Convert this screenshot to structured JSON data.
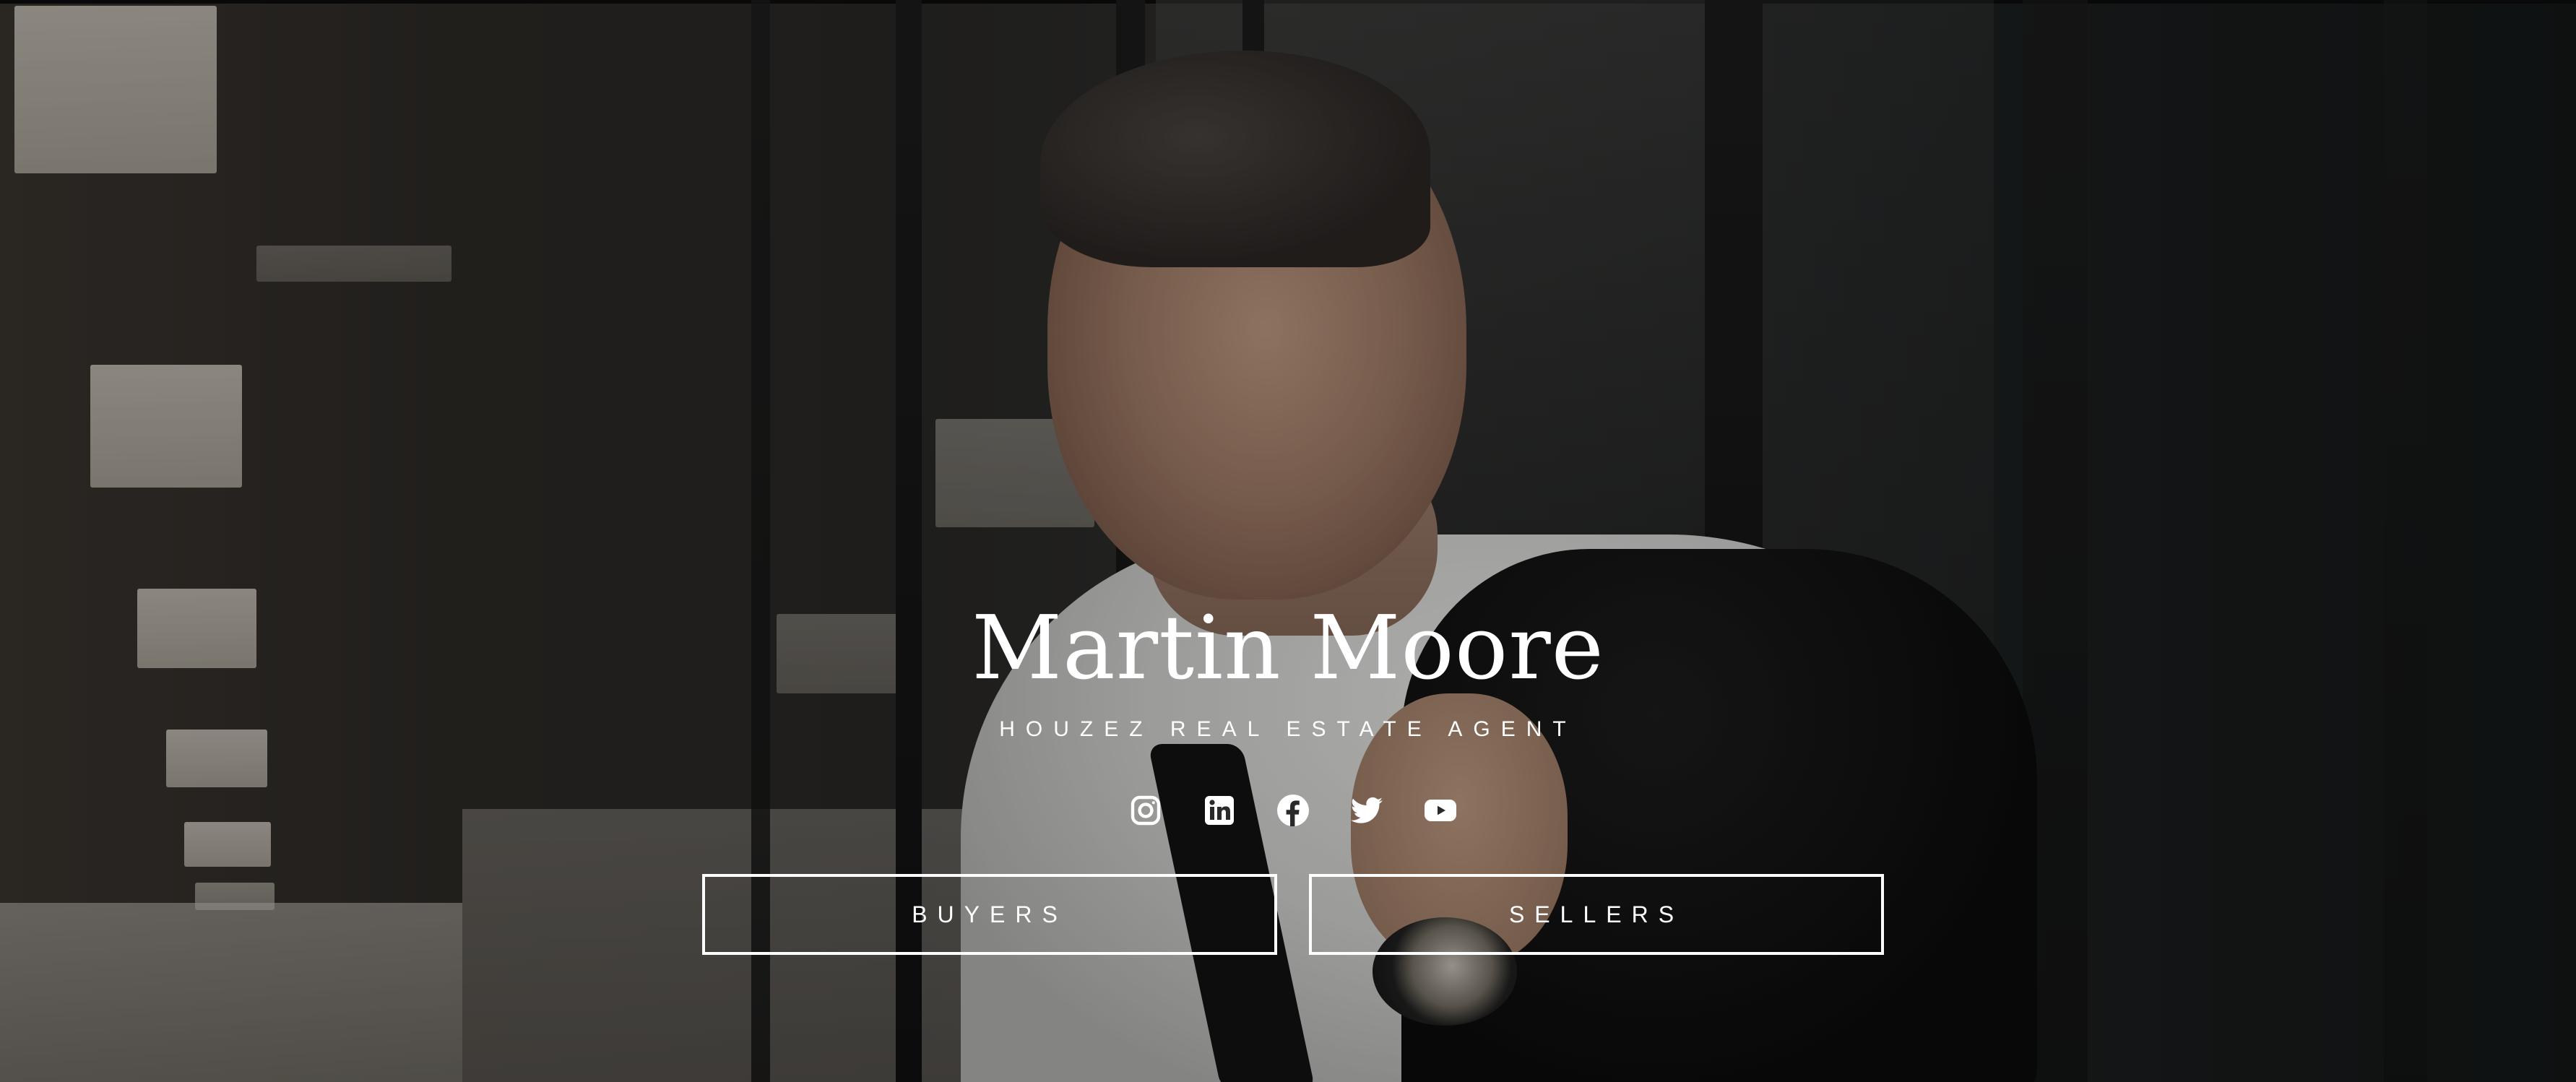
{
  "hero": {
    "name": "Martin Moore",
    "subtitle": "HOUZEZ REAL ESTATE AGENT",
    "overlay_color": "#000000"
  },
  "socials": [
    {
      "icon": "instagram-icon"
    },
    {
      "icon": "linkedin-icon"
    },
    {
      "icon": "facebook-icon"
    },
    {
      "icon": "twitter-icon"
    },
    {
      "icon": "youtube-icon"
    }
  ],
  "buttons": {
    "buyers_label": "BUYERS",
    "sellers_label": "SELLERS"
  },
  "colors": {
    "text": "#ffffff",
    "button_border": "#ffffff"
  }
}
